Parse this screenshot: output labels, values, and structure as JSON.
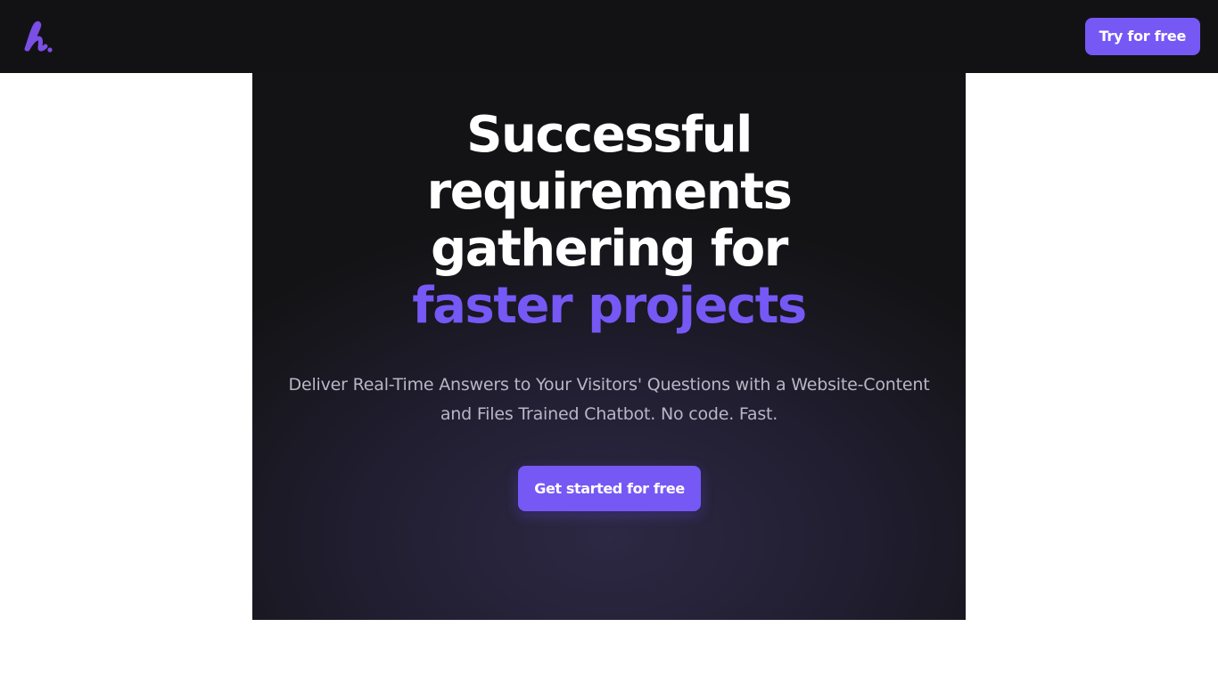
{
  "header": {
    "logo_icon": "brand-logo-icon",
    "try_label": "Try for free"
  },
  "hero": {
    "headline_lines": [
      "Successful",
      "requirements",
      "gathering for"
    ],
    "headline_accent": "faster projects",
    "subtext": "Deliver Real-Time Answers to Your Visitors' Questions with a Website-Content and Files Trained Chatbot. No code. Fast.",
    "cta_label": "Get started for free"
  },
  "colors": {
    "accent": "#7658f5",
    "topbar_bg": "#121215",
    "hero_text": "#ffffff",
    "subtext": "#b9b6c6"
  }
}
